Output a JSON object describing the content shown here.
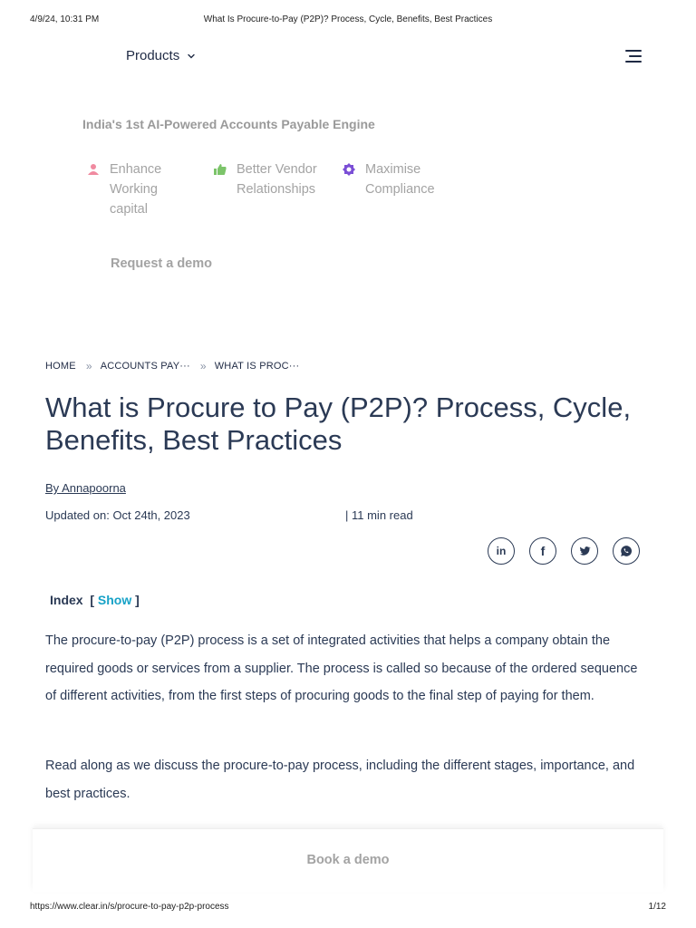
{
  "print_header": {
    "datetime": "4/9/24, 10:31 PM",
    "doc_title": "What Is Procure-to-Pay (P2P)? Process, Cycle, Benefits, Best Practices"
  },
  "nav": {
    "products_label": "Products",
    "products_icon": "chevron-down-icon",
    "menu_icon": "hamburger-menu-icon"
  },
  "promo": {
    "title": "India's 1st AI-Powered Accounts Payable Engine",
    "features": [
      {
        "label": "Enhance Working capital",
        "icon": "person-icon",
        "color": "#f08aa0"
      },
      {
        "label": "Better Vendor Relationships",
        "icon": "thumbs-up-icon",
        "color": "#7cc46a"
      },
      {
        "label": "Maximise Compliance",
        "icon": "badge-icon",
        "color": "#7b4fd6"
      }
    ],
    "cta_label": "Request a demo"
  },
  "breadcrumb": {
    "items": [
      "HOME",
      "ACCOUNTS PAY···",
      "WHAT IS PROC···"
    ],
    "separator": "»"
  },
  "article": {
    "title": "What is Procure to Pay (P2P)? Process, Cycle, Benefits, Best Practices",
    "author": "By Annapoorna",
    "updated": "Updated on: Oct 24th, 2023",
    "read_time": "| 11 min read",
    "share": [
      {
        "name": "linkedin",
        "label": "in"
      },
      {
        "name": "facebook",
        "label": "f"
      },
      {
        "name": "twitter",
        "label": ""
      },
      {
        "name": "whatsapp",
        "label": ""
      }
    ],
    "index_label": "Index",
    "index_open": "[",
    "index_show": "Show",
    "index_close": "]",
    "paragraphs": [
      "The procure-to-pay (P2P) process is a set of integrated activities that helps a company obtain the required goods or services from a supplier. The process is called so because of the ordered sequence of different activities, from the first steps of procuring goods to the final step of paying for them.",
      "Read along as we discuss the procure-to-pay process, including the different stages, importance, and best practices."
    ]
  },
  "bottom_bar": {
    "book_label": "Book a demo"
  },
  "print_footer": {
    "url": "https://www.clear.in/s/procure-to-pay-p2p-process",
    "page": "1/12"
  },
  "colors": {
    "text": "#2b3a55",
    "muted": "#a3a3a3",
    "link_accent": "#17a2c7"
  }
}
